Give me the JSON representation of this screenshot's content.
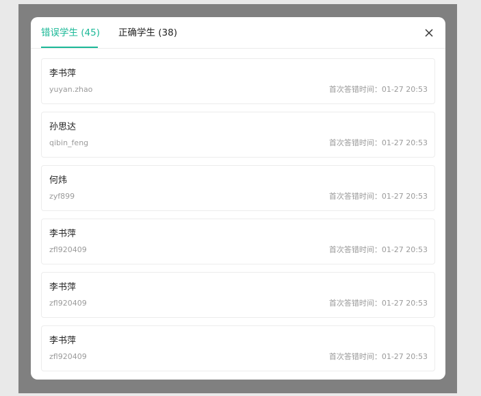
{
  "tabs": [
    {
      "label": "错误学生 (45)",
      "active": true
    },
    {
      "label": "正确学生 (38)",
      "active": false
    }
  ],
  "close": {
    "icon": "close-icon"
  },
  "accent_color": "#1bb897",
  "students": [
    {
      "name": "李书萍",
      "username": "yuyan.zhao",
      "time": "首次答错时间：01-27 20:53"
    },
    {
      "name": "孙思达",
      "username": "qibin_feng",
      "time": "首次答错时间：01-27 20:53"
    },
    {
      "name": "何炜",
      "username": "zyf899",
      "time": "首次答错时间：01-27 20:53"
    },
    {
      "name": "李书萍",
      "username": "zfl920409",
      "time": "首次答错时间：01-27 20:53"
    },
    {
      "name": "李书萍",
      "username": "zfl920409",
      "time": "首次答错时间：01-27 20:53"
    },
    {
      "name": "李书萍",
      "username": "zfl920409",
      "time": "首次答错时间：01-27 20:53"
    }
  ]
}
